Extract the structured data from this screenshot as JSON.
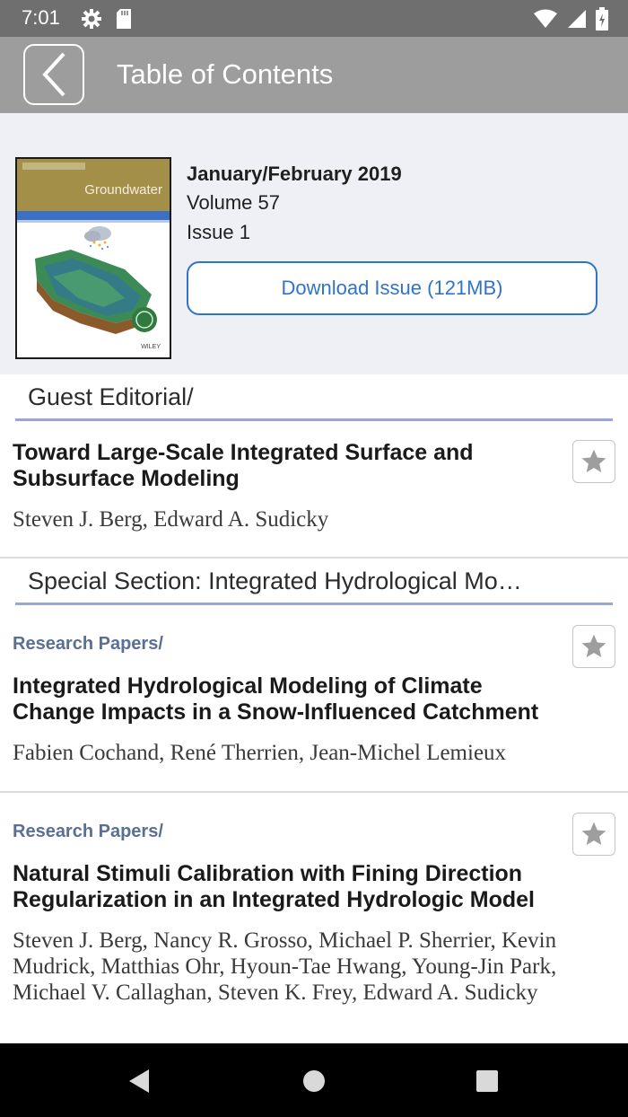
{
  "status_bar": {
    "time": "7:01",
    "left_icons": [
      "gear-icon",
      "sd-card-icon"
    ],
    "right_icons": [
      "wifi-icon",
      "cell-signal-icon",
      "battery-icon"
    ]
  },
  "app_bar": {
    "back_icon": "chevron-left-icon",
    "title": "Table of Contents"
  },
  "issue": {
    "cover_title": "Groundwater",
    "date": "January/February 2019",
    "volume": "Volume 57",
    "issue_number": "Issue 1",
    "download_label": "Download Issue (121MB)"
  },
  "sections": [
    {
      "title": "Guest Editorial/"
    },
    {
      "title": "Special Section: Integrated Hydrological Mo…"
    }
  ],
  "articles": [
    {
      "category": "",
      "title": "Toward Large-Scale Integrated Surface and Subsurface Modeling",
      "authors": "Steven J. Berg, Edward A. Sudicky"
    },
    {
      "category": "Research Papers/",
      "title": "Integrated Hydrological Modeling of Climate Change Impacts in a Snow-Influenced Catchment",
      "authors": "Fabien Cochand, René Therrien, Jean-Michel Lemieux"
    },
    {
      "category": "Research Papers/",
      "title": "Natural Stimuli Calibration with Fining Direction Regularization in an Integrated Hydrologic Model",
      "authors": "Steven J. Berg, Nancy R. Grosso, Michael P. Sherrier, Kevin Mudrick, Matthias Ohr, Hyoun-Tae Hwang, Young-Jin Park, Michael V. Callaghan, Steven K. Frey, Edward A. Sudicky"
    }
  ],
  "nav_bar": {
    "icons": [
      "nav-back-icon",
      "nav-home-icon",
      "nav-recents-icon"
    ]
  },
  "colors": {
    "status_bar": "#6f6f6f",
    "app_bar": "#9d9d9d",
    "header_bg": "#eef0f5",
    "accent_blue": "#2f74c9",
    "category": "#5a6f94",
    "section_rule": "#9aa6d4"
  }
}
